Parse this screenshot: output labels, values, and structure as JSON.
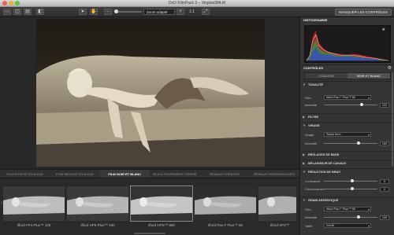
{
  "window": {
    "title": "DxO FilmPack 3 – Virginie984.tif"
  },
  "toolbar": {
    "zoom_value": "Zoom adapté",
    "ratio_label": "1:1",
    "hide_controls_label": "MASQUER LES CONTRÔLES"
  },
  "film_tabs": [
    {
      "label": "FILM POSITIF COULEUR"
    },
    {
      "label": "FILM NÉGATIF COULEUR"
    },
    {
      "label": "FILM NOIR ET BLANC"
    },
    {
      "label": "FILM À TRAITEMENT CROISÉ"
    },
    {
      "label": "RENDUS CRÉATIFS"
    },
    {
      "label": "RENDUS PERSONNALISÉS"
    }
  ],
  "active_film_tab": 2,
  "thumbnails": [
    {
      "label": "Ilford FP4 Plus™ 125"
    },
    {
      "label": "Ilford HP5 Plus™ 400"
    },
    {
      "label": "Ilford HPS™ 800"
    },
    {
      "label": "Ilford Pan F Plus™ 50"
    },
    {
      "label": "Ilford XP2™"
    }
  ],
  "panel": {
    "histogram_title": "HISTOGRAMME",
    "controls_title": "CONTRÔLES",
    "tabs": [
      {
        "label": "COULEUR"
      },
      {
        "label": "NOIR ET BLANC"
      }
    ],
    "active_tab": 1,
    "tonalite": {
      "title": "TONALITÉ",
      "film_label": "Film",
      "film_value": "Ilford Pan F Plus™ 50",
      "intensity_label": "Intensité",
      "intensity_value": "122"
    },
    "filtre": {
      "title": "FILTRE"
    },
    "virage": {
      "title": "VIRAGE",
      "virage_label": "Virage",
      "virage_value": "Sépia terre",
      "intensity_label": "Intensité",
      "intensity_value": "100"
    },
    "reglages_title": "RÉGLAGES DE BASE",
    "melangeur_title": "MÉLANGEUR DE CANAUX",
    "bruit": {
      "title": "RÉDUCTION DE BRUIT",
      "luminance_label": "Luminance",
      "luminance_value": "0",
      "chrominance_label": "Chrominance",
      "chrominance_value": "0"
    },
    "grain": {
      "title": "GRAIN ARGENTIQUE",
      "film_label": "Film",
      "film_value": "Ilford Pan F Plus™ 50",
      "intensity_label": "Intensité",
      "intensity_value": "100",
      "taille_label": "Taille",
      "taille_value": "24x36"
    }
  },
  "colors": {
    "panel_bg": "#353535",
    "accent": "#e6e6e6",
    "window_bg": "#2b2b2b"
  }
}
